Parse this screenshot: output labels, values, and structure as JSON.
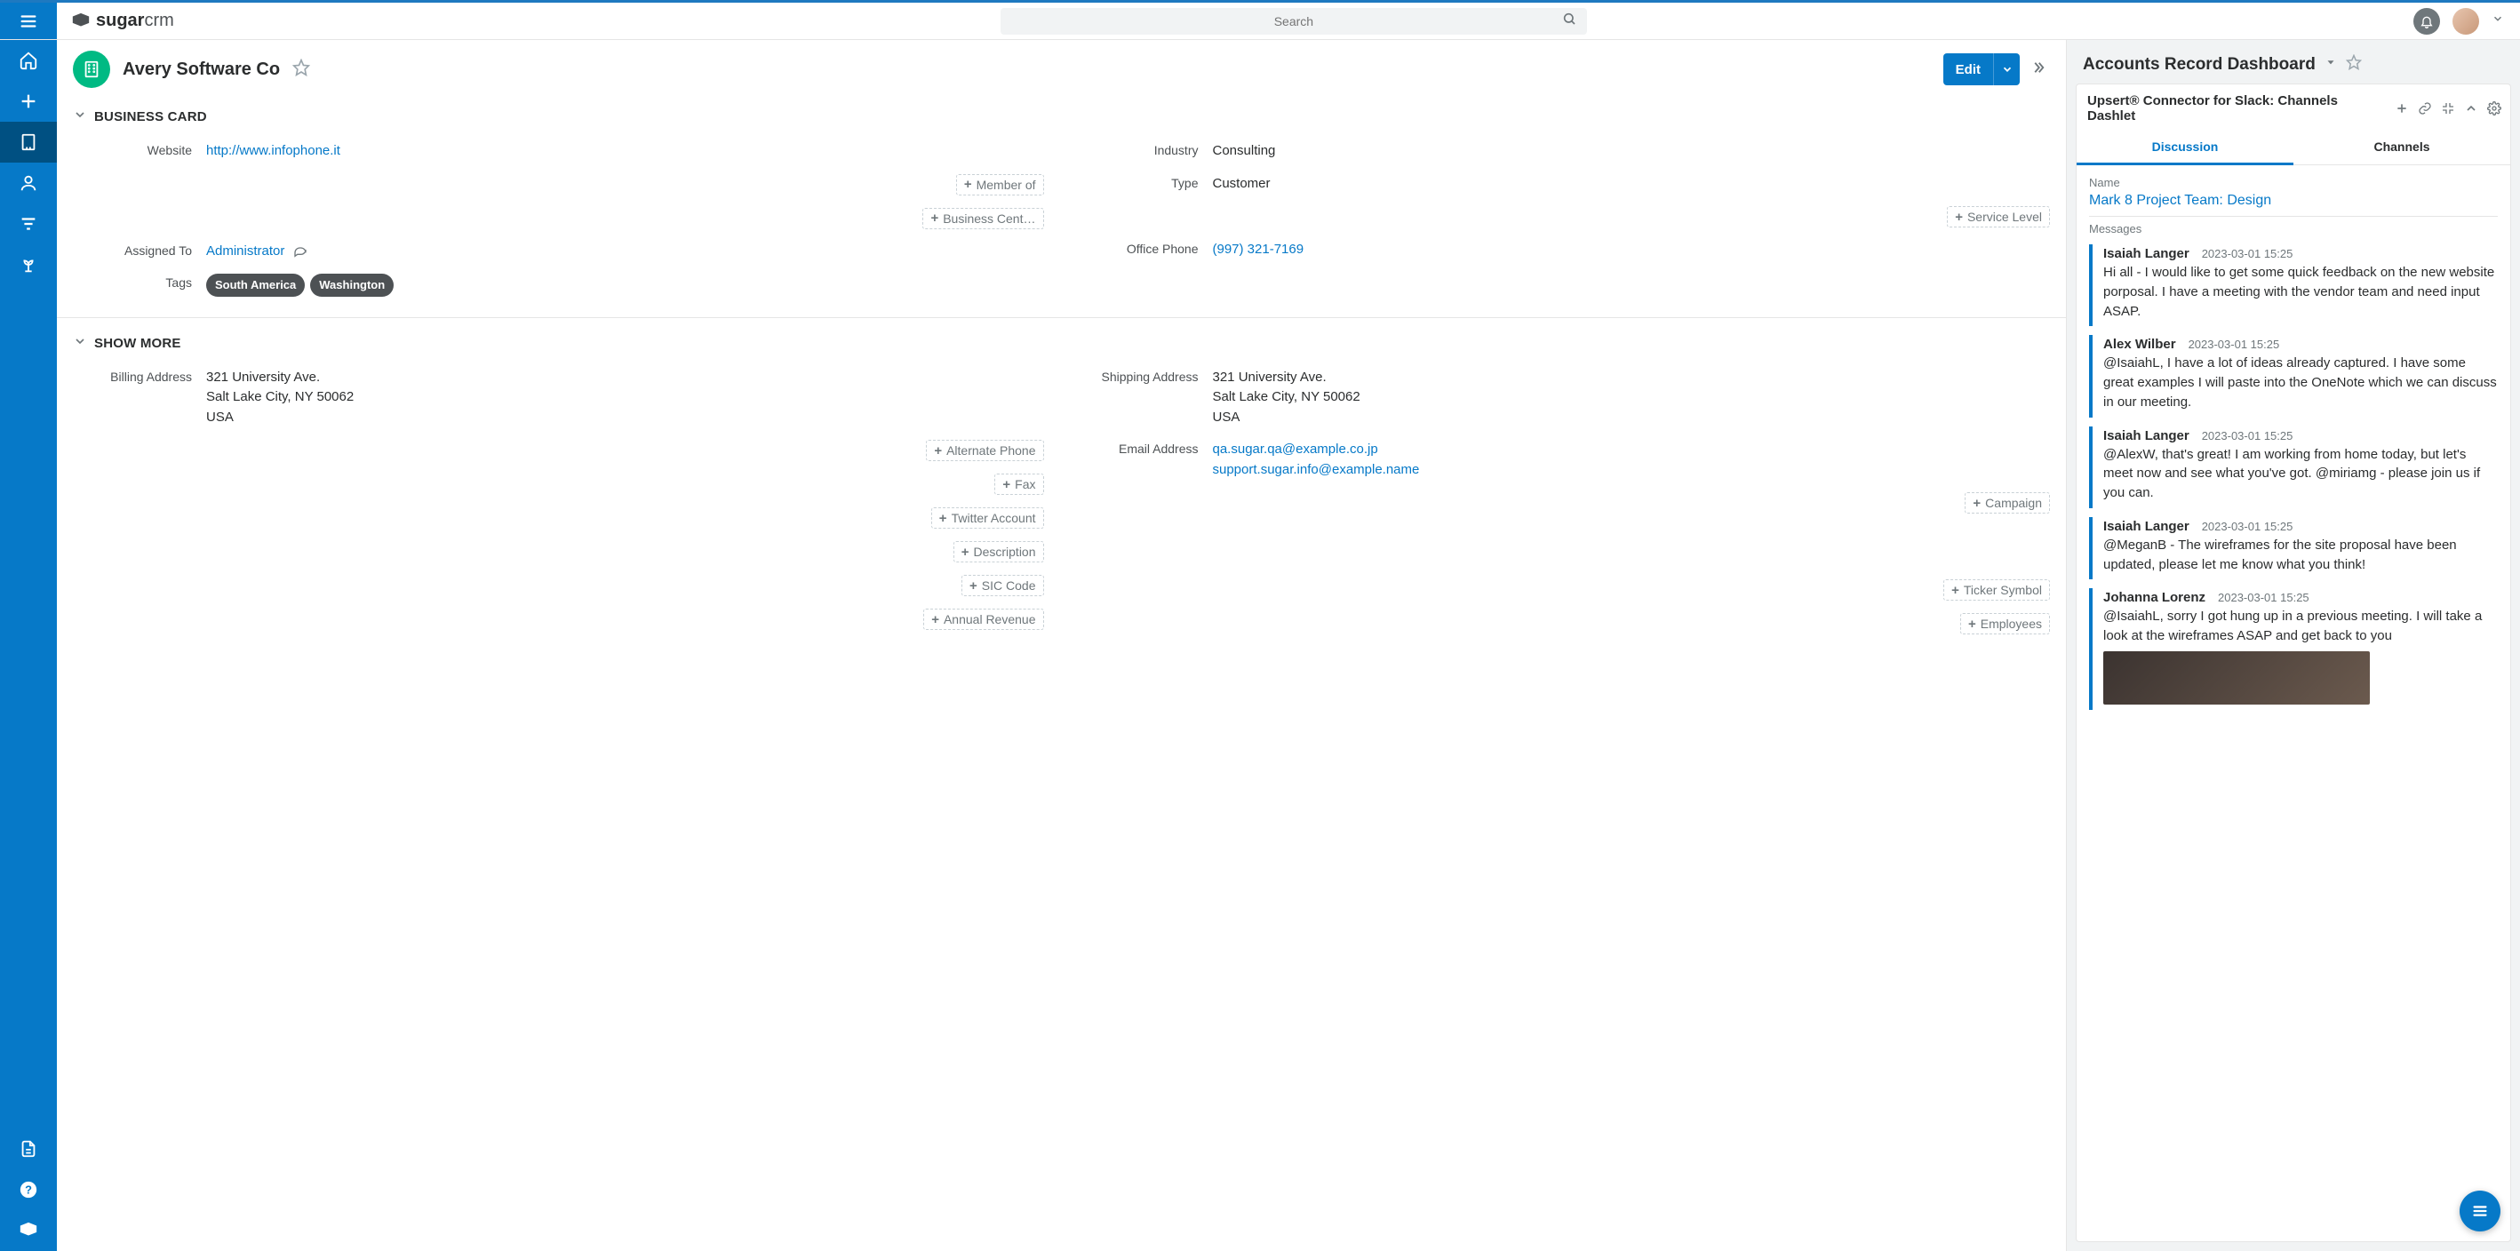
{
  "brand": {
    "prefix": "sugar",
    "suffix": "crm"
  },
  "search": {
    "placeholder": "Search"
  },
  "record": {
    "title": "Avery Software Co",
    "edit_label": "Edit",
    "sections": {
      "business_card": {
        "title": "BUSINESS CARD",
        "website_label": "Website",
        "website_value": "http://www.infophone.it",
        "member_of_label": "Member of",
        "business_center_label": "Business Cent…",
        "assigned_to_label": "Assigned To",
        "assigned_to_value": "Administrator",
        "tags_label": "Tags",
        "tags": [
          "South America",
          "Washington"
        ],
        "industry_label": "Industry",
        "industry_value": "Consulting",
        "type_label": "Type",
        "type_value": "Customer",
        "service_level_label": "Service Level",
        "office_phone_label": "Office Phone",
        "office_phone_value": "(997) 321-7169"
      },
      "show_more": {
        "title": "SHOW MORE",
        "billing_address_label": "Billing Address",
        "billing_address_value": "321 University Ave.\nSalt Lake City, NY 50062\nUSA",
        "alternate_phone_label": "Alternate Phone",
        "fax_label": "Fax",
        "twitter_label": "Twitter Account",
        "description_label": "Description",
        "sic_label": "SIC Code",
        "annual_revenue_label": "Annual Revenue",
        "shipping_address_label": "Shipping Address",
        "shipping_address_value": "321 University Ave.\nSalt Lake City, NY 50062\nUSA",
        "email_label": "Email Address",
        "emails": [
          "qa.sugar.qa@example.co.jp",
          "support.sugar.info@example.name"
        ],
        "campaign_label": "Campaign",
        "ticker_label": "Ticker Symbol",
        "employees_label": "Employees"
      }
    }
  },
  "dashboard": {
    "title": "Accounts Record Dashboard",
    "dashlet": {
      "title": "Upsert® Connector for Slack: Channels Dashlet",
      "tabs": {
        "discussion": "Discussion",
        "channels": "Channels"
      },
      "name_label": "Name",
      "channel_name": "Mark 8 Project Team: Design",
      "messages_label": "Messages",
      "messages": [
        {
          "author": "Isaiah Langer",
          "ts": "2023-03-01 15:25",
          "body": "Hi all - I would like to get some quick feedback on the new website porposal. I have a meeting with the vendor team and need input ASAP."
        },
        {
          "author": "Alex Wilber",
          "ts": "2023-03-01 15:25",
          "body": "@IsaiahL, I have a lot of ideas already captured. I have some great examples I will paste into the OneNote which we can discuss in our meeting."
        },
        {
          "author": "Isaiah Langer",
          "ts": "2023-03-01 15:25",
          "body": "@AlexW, that's great! I am working from home today, but let's meet now and see what you've got. @miriamg - please join us if you can."
        },
        {
          "author": "Isaiah Langer",
          "ts": "2023-03-01 15:25",
          "body": "@MeganB - The wireframes for the site proposal have been updated, please let me know what you think!"
        },
        {
          "author": "Johanna Lorenz",
          "ts": "2023-03-01 15:25",
          "body": "@IsaiahL, sorry I got hung up in a previous meeting. I will take a look at the wireframes ASAP and get back to you",
          "has_image": true
        }
      ]
    }
  }
}
